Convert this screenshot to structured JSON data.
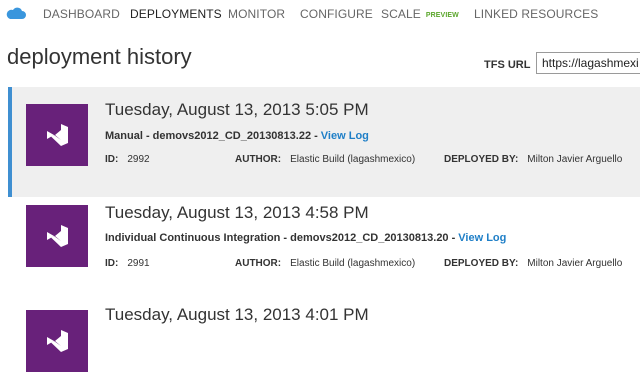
{
  "nav": {
    "items": [
      "DASHBOARD",
      "DEPLOYMENTS",
      "MONITOR",
      "CONFIGURE",
      "SCALE",
      "LINKED RESOURCES"
    ],
    "active": "DEPLOYMENTS",
    "scale_badge": "PREVIEW"
  },
  "page": {
    "title": "deployment history",
    "tfs_label": "TFS URL",
    "tfs_value": "https://lagashmexi"
  },
  "labels": {
    "id": "ID:",
    "author": "AUTHOR:",
    "deployed_by": "DEPLOYED BY:",
    "view_log": "View Log"
  },
  "deployments": [
    {
      "date": "Tuesday, August 13, 2013 5:05 PM",
      "description": "Manual - demovs2012_CD_20130813.22 -",
      "id": "2992",
      "author": "Elastic Build (lagashmexico)",
      "deployed_by": "Milton Javier Arguello",
      "selected": true
    },
    {
      "date": "Tuesday, August 13, 2013 4:58 PM",
      "description": "Individual Continuous Integration - demovs2012_CD_20130813.20 -",
      "id": "2991",
      "author": "Elastic Build (lagashmexico)",
      "deployed_by": "Milton Javier Arguello",
      "selected": false
    },
    {
      "date": "Tuesday, August 13, 2013 4:01 PM",
      "selected": false
    }
  ],
  "colors": {
    "accent": "#3f8fd1",
    "vs_purple": "#68217a",
    "link": "#1f7fc7",
    "preview": "#5aa62a"
  }
}
